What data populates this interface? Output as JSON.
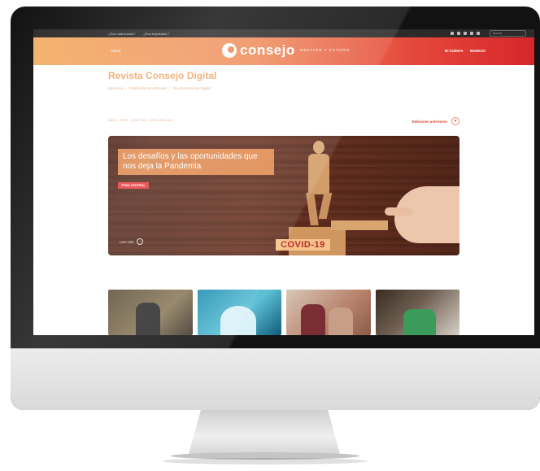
{
  "site": {
    "top_links": [
      "¿Sos matriculado?",
      "¿Sos empleador?"
    ],
    "search_placeholder": "Buscar",
    "brand": {
      "name": "consejo",
      "tagline": "GESTIÓN Y FUTURO"
    },
    "menu_label": "Menú",
    "nav_right": [
      "MI CUENTA",
      "INGRESO"
    ],
    "colors": {
      "accent": "#f0a96a",
      "brand_red": "#d6262a",
      "brand_orange": "#f3b06a"
    }
  },
  "page": {
    "title": "Revista Consejo Digital",
    "breadcrumb": [
      "Servicios",
      "Publicaciones y Prensa",
      "Revista Consejo Digital"
    ],
    "edition_meta": "AÑO 6 · Nº 62 · JUNIO 2020 · ISSN 1851-4442",
    "editions_label": "Ediciones anteriores"
  },
  "hero": {
    "title": "Los desafíos y las oportunidades que nos deja la Pandemia",
    "tag": "TEMA CENTRAL",
    "read_more": "Leer más",
    "image_text": "COVID-19"
  },
  "thumbnails": [
    {
      "name": "thumbnail-1"
    },
    {
      "name": "thumbnail-2"
    },
    {
      "name": "thumbnail-3"
    },
    {
      "name": "thumbnail-4"
    }
  ]
}
